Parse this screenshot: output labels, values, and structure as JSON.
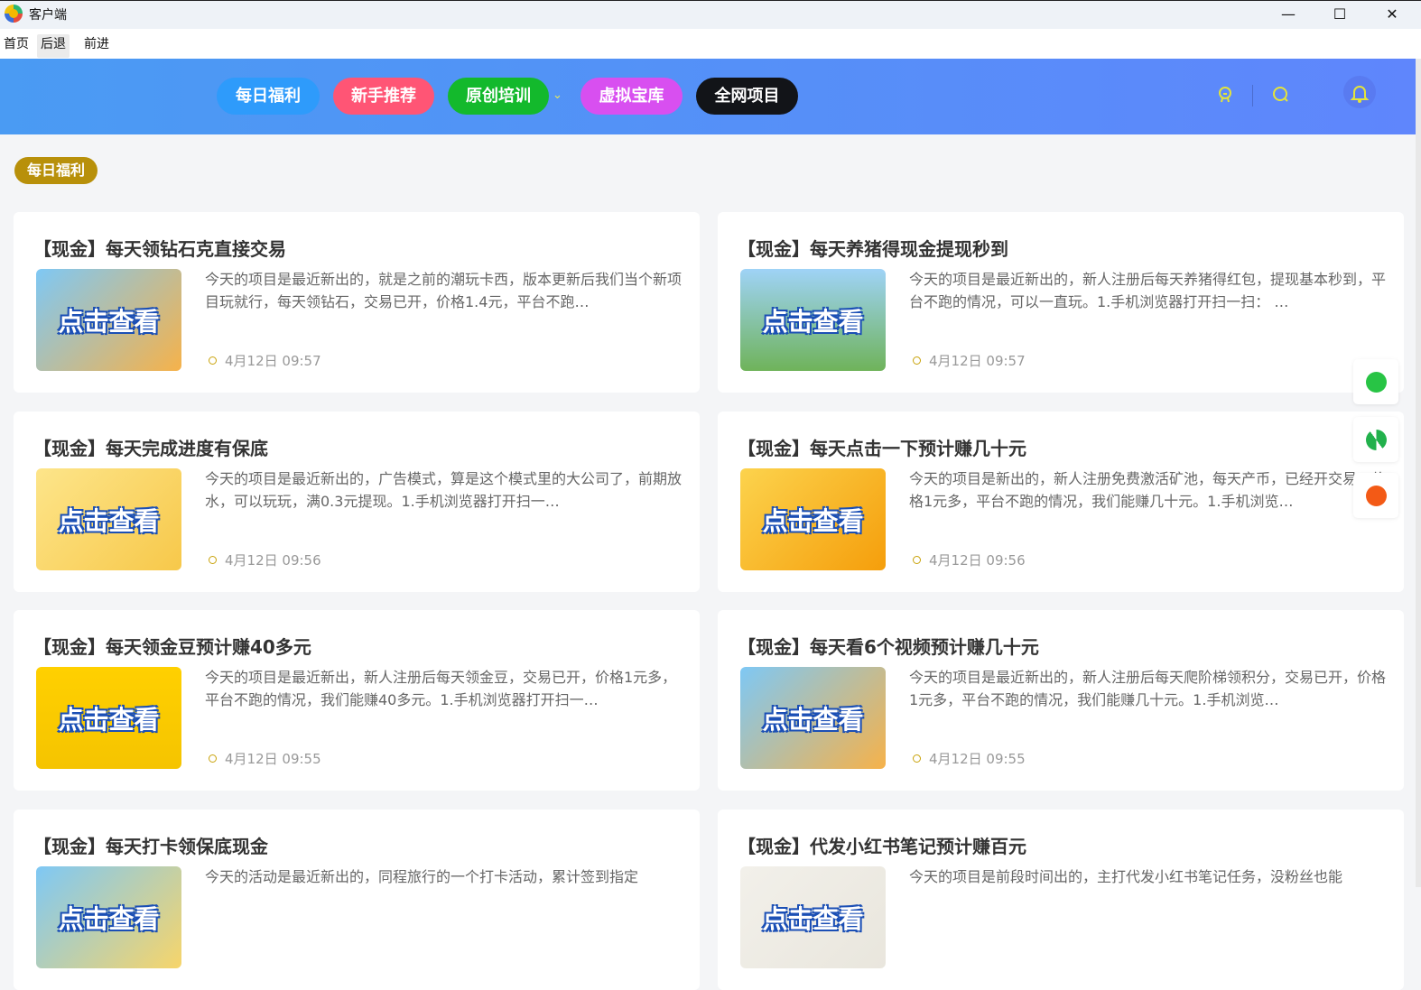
{
  "window": {
    "title": "客户端",
    "minimize": "—",
    "maximize": "☐",
    "close": "✕"
  },
  "menu": [
    "首页",
    "后退",
    "前进"
  ],
  "nav": [
    {
      "label": "每日福利",
      "color": "#2e9bfb"
    },
    {
      "label": "新手推荐",
      "color": "#ff5575"
    },
    {
      "label": "原创培训",
      "color": "#13b92c",
      "dropdown": true
    },
    {
      "label": "虚拟宝库",
      "color": "#d84ff0"
    },
    {
      "label": "全网项目",
      "color": "#121418"
    }
  ],
  "header_icons": [
    "award-icon",
    "search-icon",
    "bell-icon"
  ],
  "section_tag": "每日福利",
  "thumb_text": "点击查看",
  "cards": [
    {
      "title": "【现金】每天领钻石克直接交易",
      "desc": "今天的项目是最近新出的，就是之前的潮玩卡西，版本更新后我们当个新项目玩就行，每天领钻石，交易已开，价格1.4元，平台不跑…",
      "date": "4月12日 09:57"
    },
    {
      "title": "【现金】每天养猪得现金提现秒到",
      "desc": "今天的项目是最近新出的，新人注册后每天养猪得红包，提现基本秒到，平台不跑的情况，可以一直玩。1.手机浏览器打开扫一扫：  …",
      "date": "4月12日 09:57"
    },
    {
      "title": "【现金】每天完成进度有保底",
      "desc": "今天的项目是最近新出的，广告模式，算是这个模式里的大公司了，前期放水，可以玩玩，满0.3元提现。1.手机浏览器打开扫一…",
      "date": "4月12日 09:56"
    },
    {
      "title": "【现金】每天点击一下预计赚几十元",
      "desc": "今天的项目是新出的，新人注册免费激活矿池，每天产币，已经开交易，价格1元多，平台不跑的情况，我们能赚几十元。1.手机浏览…",
      "date": "4月12日 09:56"
    },
    {
      "title": "【现金】每天领金豆预计赚40多元",
      "desc": "今天的项目是最近新出，新人注册后每天领金豆，交易已开，价格1元多，平台不跑的情况，我们能赚40多元。1.手机浏览器打开扫一…",
      "date": "4月12日 09:55"
    },
    {
      "title": "【现金】每天看6个视频预计赚几十元",
      "desc": "今天的项目是最近新出的，新人注册后每天爬阶梯领积分，交易已开，价格1元多，平台不跑的情况，我们能赚几十元。1.手机浏览…",
      "date": "4月12日 09:55"
    },
    {
      "title": "【现金】每天打卡领保底现金",
      "desc": "今天的活动是最近新出的，同程旅行的一个打卡活动，累计签到指定",
      "date": ""
    },
    {
      "title": "【现金】代发小红书笔记预计赚百元",
      "desc": "今天的项目是前段时间出的，主打代发小红书笔记任务，没粉丝也能",
      "date": ""
    }
  ],
  "float_buttons": [
    {
      "icon": "wechat-icon",
      "color": "#28c445"
    },
    {
      "icon": "refresh-icon",
      "color": "#22b14c"
    },
    {
      "icon": "chat-icon",
      "color": "#f35a16"
    }
  ]
}
